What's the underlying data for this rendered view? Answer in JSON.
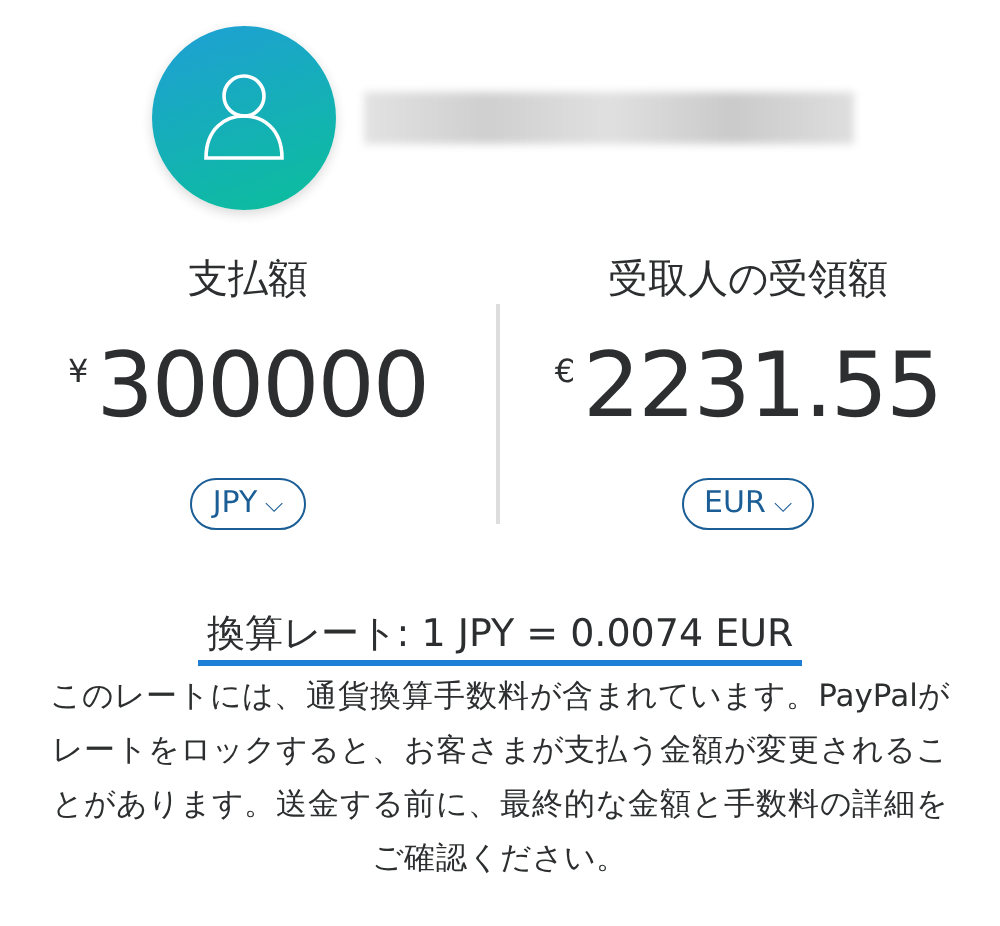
{
  "payer": {
    "label": "支払額",
    "symbol": "¥",
    "amount": "300000",
    "currency": "JPY",
    "caret": "⌵"
  },
  "recipient": {
    "label": "受取人の受領額",
    "symbol": "€",
    "amount": "2231.55",
    "currency": "EUR",
    "caret": "⌵"
  },
  "rate": "換算レート: 1 JPY = 0.0074 EUR",
  "note": "このレートには、通貨換算手数料が含まれています。PayPalがレートをロックすると、お客さまが支払う金額が変更されることがあります。送金する前に、最終的な金額と手数料の詳細をご確認ください。"
}
